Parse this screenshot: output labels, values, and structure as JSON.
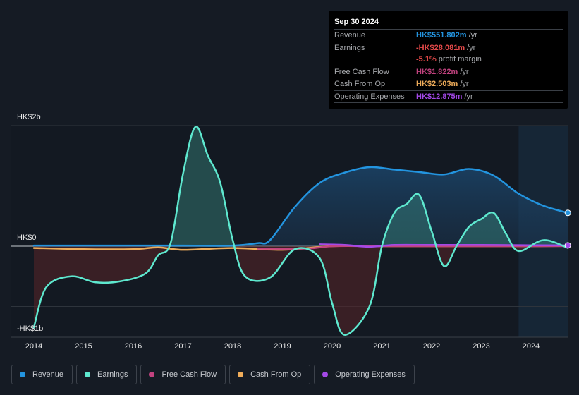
{
  "tooltip": {
    "date": "Sep 30 2024",
    "rows": [
      {
        "label": "Revenue",
        "value": "HK$551.802m",
        "unit": "/yr",
        "color": "#2394df"
      },
      {
        "label": "Earnings",
        "value": "-HK$28.081m",
        "unit": "/yr",
        "color": "#e64a4a"
      },
      {
        "label": "",
        "value": "-5.1%",
        "unit": "profit margin",
        "color": "#e64a4a"
      },
      {
        "label": "Free Cash Flow",
        "value": "HK$1.822m",
        "unit": "/yr",
        "color": "#c2427f"
      },
      {
        "label": "Cash From Op",
        "value": "HK$2.503m",
        "unit": "/yr",
        "color": "#f0ad5a"
      },
      {
        "label": "Operating Expenses",
        "value": "HK$12.875m",
        "unit": "/yr",
        "color": "#a449e8"
      }
    ]
  },
  "legend": [
    {
      "label": "Revenue",
      "color": "#2394df"
    },
    {
      "label": "Earnings",
      "color": "#5ee8cf"
    },
    {
      "label": "Free Cash Flow",
      "color": "#c2427f"
    },
    {
      "label": "Cash From Op",
      "color": "#f0ad5a"
    },
    {
      "label": "Operating Expenses",
      "color": "#a449e8"
    }
  ],
  "chart_data": {
    "type": "area",
    "title": "",
    "xlabel": "",
    "ylabel": "",
    "y_unit": "HK$ billions",
    "ylim": [
      -1.5,
      2.0
    ],
    "xlim": [
      2013.6,
      2024.74
    ],
    "yticks": [
      {
        "value": 2,
        "label": "HK$2b"
      },
      {
        "value": 0,
        "label": "HK$0"
      },
      {
        "value": -1,
        "label": "-HK$1b"
      }
    ],
    "xticks": [
      "2014",
      "2015",
      "2016",
      "2017",
      "2018",
      "2019",
      "2020",
      "2021",
      "2022",
      "2023",
      "2024"
    ],
    "forecast_shade_start": 2023.75,
    "grid": true,
    "legend_position": "bottom-left",
    "series": [
      {
        "name": "Revenue",
        "color": "#2394df",
        "points": [
          [
            2014,
            0.01
          ],
          [
            2015,
            0.01
          ],
          [
            2016,
            0.01
          ],
          [
            2017,
            0.01
          ],
          [
            2018,
            0.01
          ],
          [
            2018.5,
            0.05
          ],
          [
            2018.75,
            0.1
          ],
          [
            2019.25,
            0.65
          ],
          [
            2019.75,
            1.05
          ],
          [
            2020.25,
            1.22
          ],
          [
            2020.75,
            1.31
          ],
          [
            2021.25,
            1.27
          ],
          [
            2021.75,
            1.23
          ],
          [
            2022.25,
            1.19
          ],
          [
            2022.75,
            1.28
          ],
          [
            2023.25,
            1.17
          ],
          [
            2023.75,
            0.87
          ],
          [
            2024.25,
            0.67
          ],
          [
            2024.74,
            0.552
          ]
        ]
      },
      {
        "name": "Earnings",
        "color": "#5ee8cf",
        "points": [
          [
            2014,
            -1.35
          ],
          [
            2014.25,
            -0.68
          ],
          [
            2014.75,
            -0.5
          ],
          [
            2015.25,
            -0.6
          ],
          [
            2015.75,
            -0.58
          ],
          [
            2016.25,
            -0.45
          ],
          [
            2016.5,
            -0.15
          ],
          [
            2016.75,
            0.05
          ],
          [
            2017,
            1.2
          ],
          [
            2017.25,
            1.98
          ],
          [
            2017.5,
            1.5
          ],
          [
            2017.75,
            1.05
          ],
          [
            2018,
            0.1
          ],
          [
            2018.25,
            -0.5
          ],
          [
            2018.75,
            -0.52
          ],
          [
            2019.25,
            -0.05
          ],
          [
            2019.75,
            -0.2
          ],
          [
            2020,
            -0.95
          ],
          [
            2020.25,
            -1.47
          ],
          [
            2020.75,
            -1.0
          ],
          [
            2021,
            0.0
          ],
          [
            2021.25,
            0.55
          ],
          [
            2021.5,
            0.7
          ],
          [
            2021.75,
            0.85
          ],
          [
            2022,
            0.25
          ],
          [
            2022.25,
            -0.33
          ],
          [
            2022.5,
            0.0
          ],
          [
            2022.75,
            0.32
          ],
          [
            2023,
            0.45
          ],
          [
            2023.25,
            0.55
          ],
          [
            2023.5,
            0.2
          ],
          [
            2023.75,
            -0.08
          ],
          [
            2024.25,
            0.1
          ],
          [
            2024.74,
            -0.028
          ]
        ]
      },
      {
        "name": "Free Cash Flow",
        "color": "#c2427f",
        "points": [
          [
            2018.5,
            -0.04
          ],
          [
            2019.5,
            -0.04
          ],
          [
            2020,
            0.0
          ],
          [
            2021,
            0.0
          ],
          [
            2022,
            0.0
          ],
          [
            2023,
            0.0
          ],
          [
            2024,
            0.0
          ],
          [
            2024.74,
            0.0018
          ]
        ]
      },
      {
        "name": "Cash From Op",
        "color": "#f0ad5a",
        "points": [
          [
            2014,
            -0.03
          ],
          [
            2015,
            -0.05
          ],
          [
            2016,
            -0.05
          ],
          [
            2016.5,
            -0.02
          ],
          [
            2017,
            -0.06
          ],
          [
            2018,
            -0.03
          ],
          [
            2019,
            -0.06
          ],
          [
            2020,
            0.0
          ],
          [
            2021,
            0.0
          ],
          [
            2022,
            0.0
          ],
          [
            2023,
            0.0
          ],
          [
            2024,
            0.0
          ],
          [
            2024.74,
            0.0025
          ]
        ]
      },
      {
        "name": "Operating Expenses",
        "color": "#a449e8",
        "points": [
          [
            2019.75,
            0.03
          ],
          [
            2020.25,
            0.02
          ],
          [
            2020.75,
            -0.01
          ],
          [
            2021.25,
            0.02
          ],
          [
            2022,
            0.02
          ],
          [
            2023,
            0.02
          ],
          [
            2024,
            0.015
          ],
          [
            2024.74,
            0.013
          ]
        ]
      }
    ]
  }
}
